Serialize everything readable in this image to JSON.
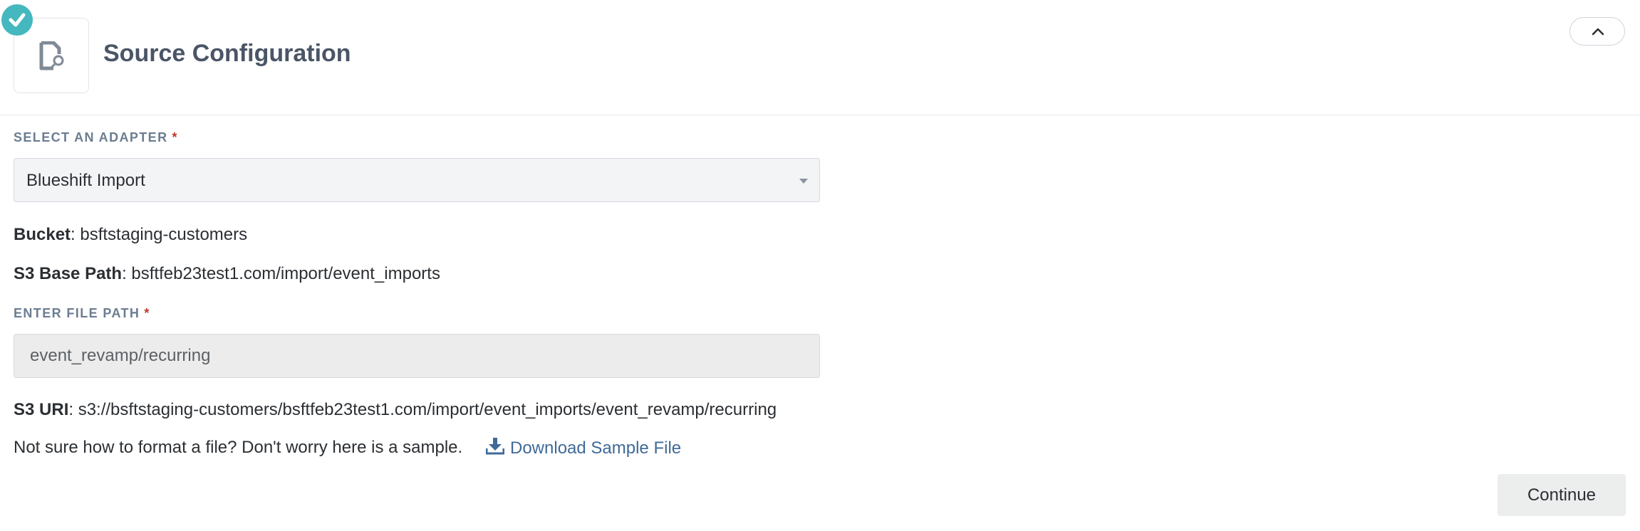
{
  "header": {
    "title": "Source Configuration",
    "step_status": "complete",
    "step_icon": "file-search-icon",
    "collapse_icon": "chevron-up-icon",
    "accent_color": "#44b8be"
  },
  "adapter": {
    "label": "Select an Adapter",
    "required_mark": "*",
    "selected": "Blueshift Import"
  },
  "bucket": {
    "label": "Bucket",
    "value": ": bsftstaging-customers"
  },
  "base_path": {
    "label": "S3 Base Path",
    "value": ": bsftfeb23test1.com/import/event_imports"
  },
  "file_path": {
    "label": "Enter File Path",
    "required_mark": "*",
    "value": "event_revamp/recurring"
  },
  "s3_uri": {
    "label": "S3 URI",
    "value": ": s3://bsftstaging-customers/bsftfeb23test1.com/import/event_imports/event_revamp/recurring"
  },
  "sample": {
    "text": "Not sure how to format a file? Don't worry here is a sample.",
    "link_label": "Download Sample File",
    "link_icon": "download-icon",
    "link_color": "#3f6a98"
  },
  "actions": {
    "continue_label": "Continue"
  }
}
